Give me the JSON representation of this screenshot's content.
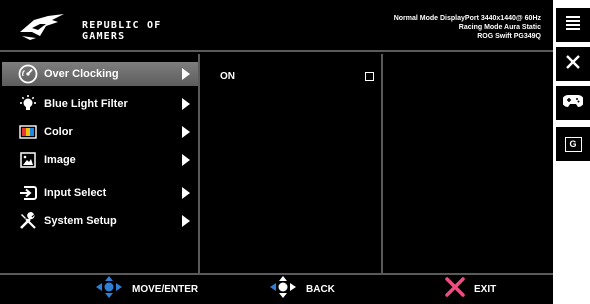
{
  "brand": {
    "line1": "REPUBLIC OF",
    "line2": "GAMERS"
  },
  "status": {
    "line1": "Normal Mode DisplayPort 3440x1440@ 60Hz",
    "line2": "Racing Mode Aura Static",
    "line3": "ROG Swift PG349Q"
  },
  "menu": {
    "items": [
      {
        "label": "Over Clocking",
        "icon": "overclock-gauge-icon",
        "selected": true
      },
      {
        "label": "Blue Light Filter",
        "icon": "light-bulb-icon",
        "selected": false
      },
      {
        "label": "Color",
        "icon": "color-palette-icon",
        "selected": false
      },
      {
        "label": "Image",
        "icon": "image-icon",
        "selected": false
      },
      {
        "label": "Input Select",
        "icon": "input-select-icon",
        "selected": false
      },
      {
        "label": "System Setup",
        "icon": "tools-icon",
        "selected": false
      }
    ]
  },
  "submenu": {
    "option_label": "ON",
    "option_checked": false
  },
  "footer": {
    "move_label": "MOVE/ENTER",
    "back_label": "BACK",
    "exit_label": "EXIT"
  },
  "side_buttons": [
    "menu-icon",
    "close-icon",
    "gamepad-icon",
    "gameplus-icon"
  ],
  "side_gameplus_letter": "G",
  "colors": {
    "background": "#000000",
    "divider": "#5a5a5a",
    "selected_gradient_top": "#7e7e7e",
    "selected_gradient_bottom": "#5d5d5d",
    "dpad_blue": "#2f7fd6",
    "exit_pink": "#ee4c84"
  }
}
